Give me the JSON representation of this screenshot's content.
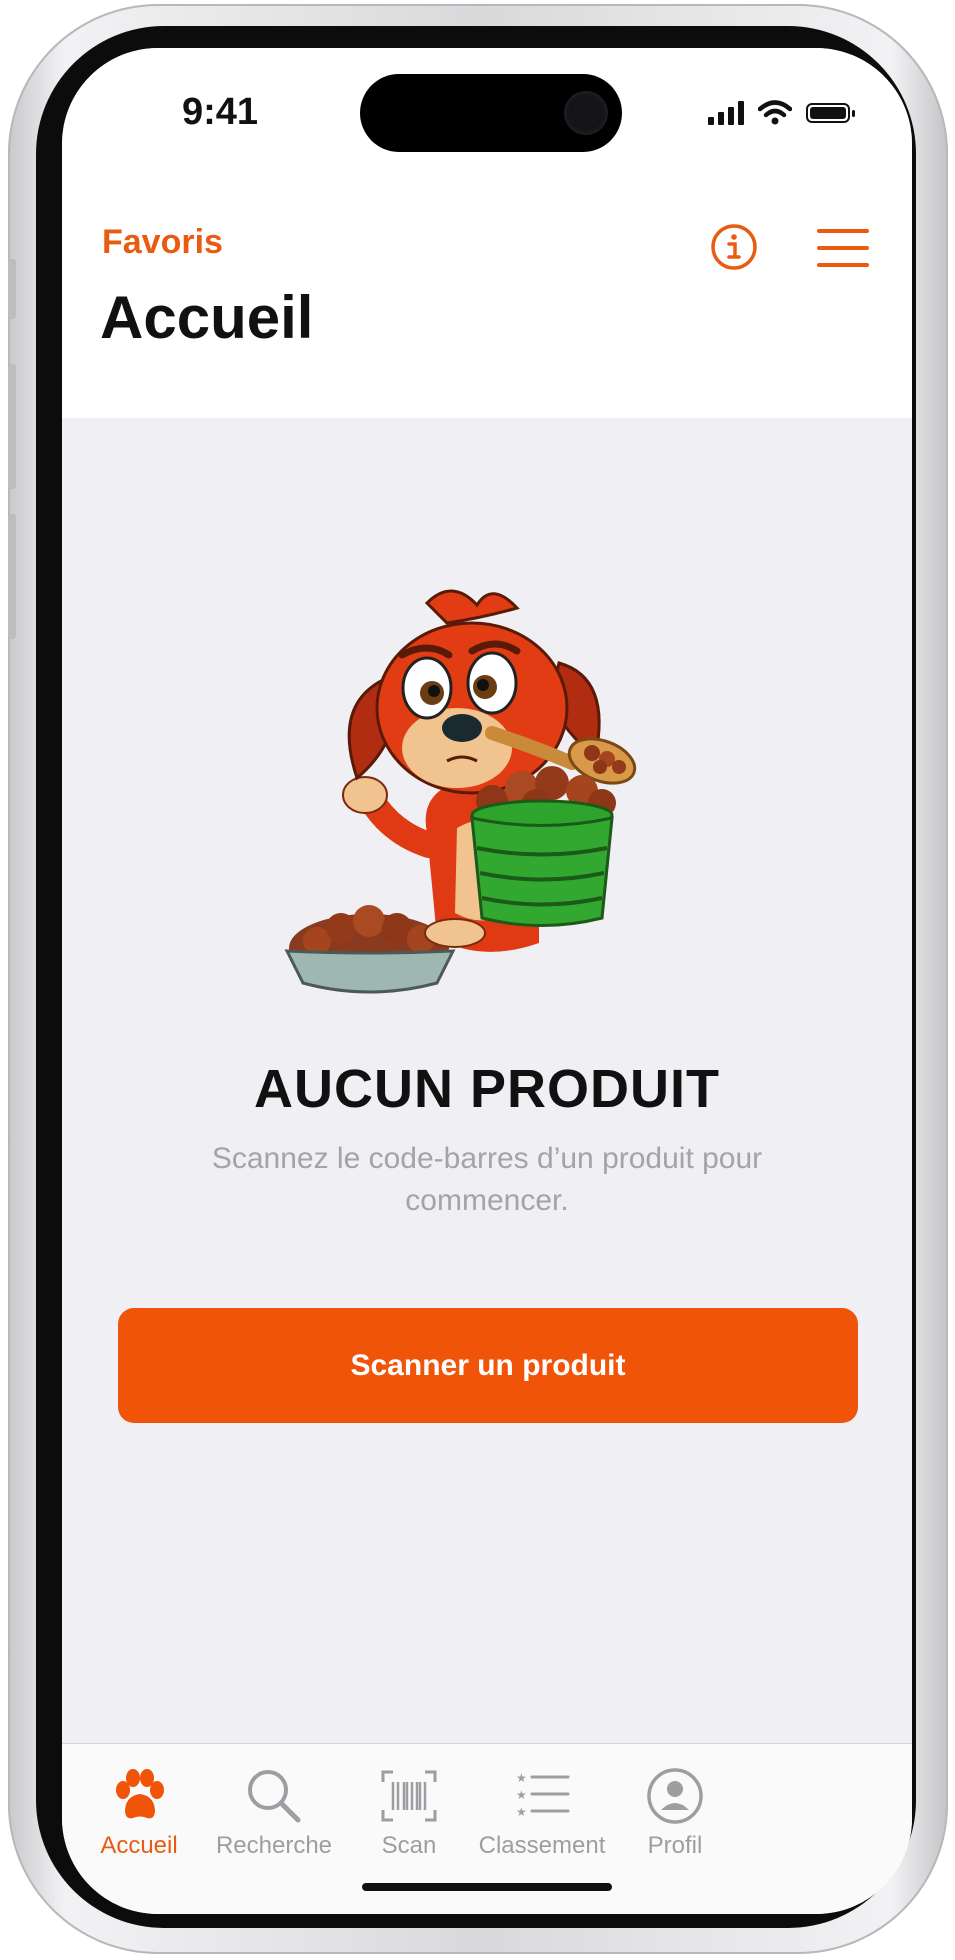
{
  "status_bar": {
    "time": "9:41"
  },
  "nav": {
    "favorites_label": "Favoris",
    "title": "Accueil"
  },
  "empty_state": {
    "headline": "AUCUN PRODUIT",
    "description": "Scannez le code-barres d’un produit pour commencer.",
    "button_label": "Scanner un produit"
  },
  "tabbar": {
    "items": [
      {
        "label": "Accueil",
        "icon": "paw-icon",
        "active": true
      },
      {
        "label": "Recherche",
        "icon": "search-icon",
        "active": false
      },
      {
        "label": "Scan",
        "icon": "barcode-scan-icon",
        "active": false
      },
      {
        "label": "Classement",
        "icon": "ranking-list-icon",
        "active": false
      },
      {
        "label": "Profil",
        "icon": "profile-icon",
        "active": false
      }
    ]
  },
  "colors": {
    "accent": "#f05408",
    "background": "#f0f0f4",
    "inactive": "#9d9da2"
  }
}
